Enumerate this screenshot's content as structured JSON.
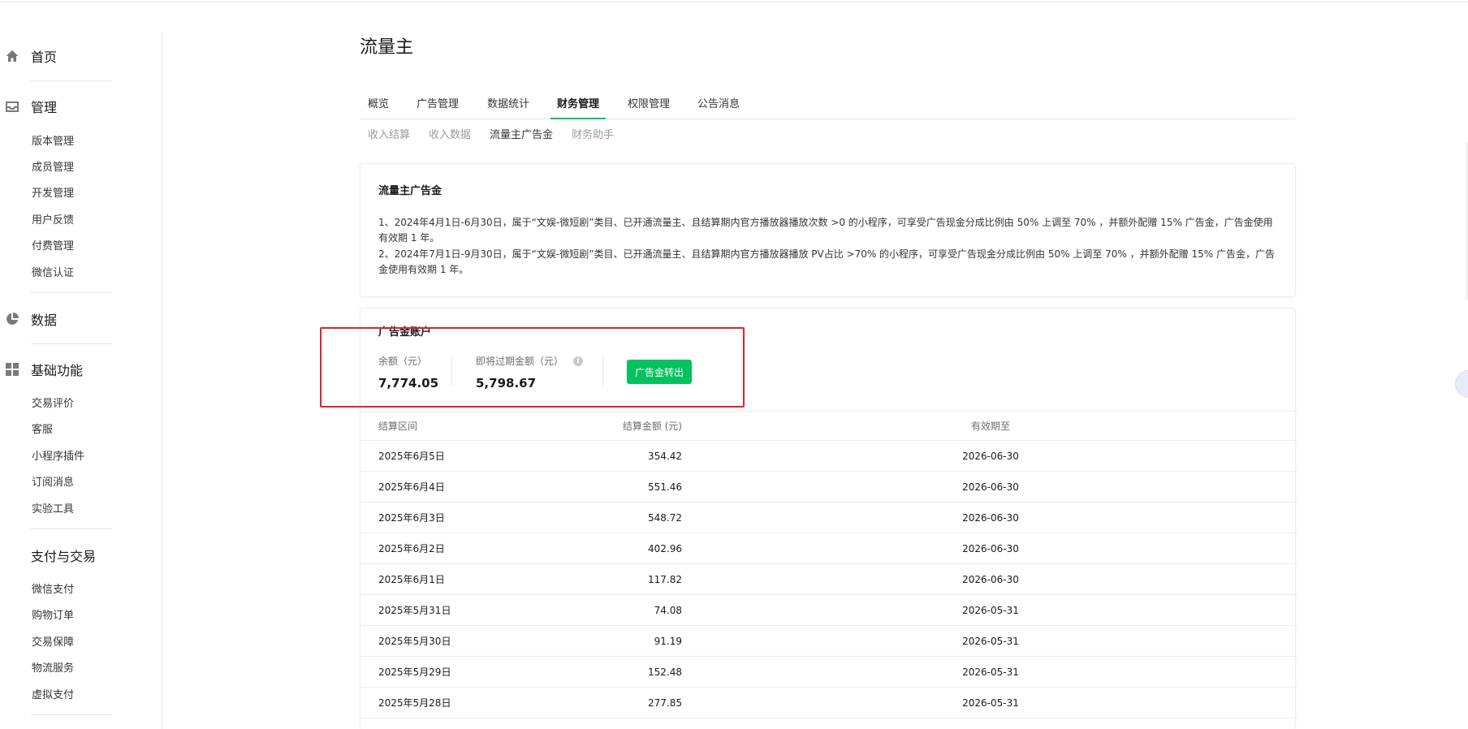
{
  "sidebar": {
    "home": "首页",
    "manage": {
      "title": "管理",
      "items": [
        "版本管理",
        "成员管理",
        "开发管理",
        "用户反馈",
        "付费管理",
        "微信认证"
      ]
    },
    "data": "数据",
    "basic": {
      "title": "基础功能",
      "items": [
        "交易评价",
        "客服",
        "小程序插件",
        "订阅消息",
        "实验工具"
      ]
    },
    "payment": {
      "title": "支付与交易",
      "items": [
        "微信支付",
        "购物订单",
        "交易保障",
        "物流服务",
        "虚拟支付"
      ]
    }
  },
  "page": {
    "title": "流量主"
  },
  "tabs": [
    "概览",
    "广告管理",
    "数据统计",
    "财务管理",
    "权限管理",
    "公告消息"
  ],
  "active_tab": "财务管理",
  "subtabs": [
    "收入结算",
    "收入数据",
    "流量主广告金",
    "财务助手"
  ],
  "active_subtab": "流量主广告金",
  "notice": {
    "title": "流量主广告金",
    "line1": "1、2024年4月1日-6月30日，属于“文娱-微短剧”类目、已开通流量主、且结算期内官方播放器播放次数 >0 的小程序，可享受广告现金分成比例由 50% 上调至 70% ，并额外配赠 15% 广告金，广告金使用有效期 1 年。",
    "line2": "2、2024年7月1日-9月30日，属于“文娱-微短剧”类目、已开通流量主、且结算期内官方播放器播放 PV占比 >70% 的小程序，可享受广告现金分成比例由 50% 上调至 70% ，并额外配赠 15% 广告金，广告金使用有效期 1 年。"
  },
  "account": {
    "title": "广告金账户",
    "balance_label": "余额（元）",
    "balance_value": "7,774.05",
    "expiring_label": "即将过期金额（元）",
    "expiring_value": "5,798.67",
    "transfer_button": "广告金转出"
  },
  "table": {
    "headers": [
      "结算区间",
      "结算金额 (元)",
      "有效期至"
    ],
    "rows": [
      [
        "2025年6月5日",
        "354.42",
        "2026-06-30"
      ],
      [
        "2025年6月4日",
        "551.46",
        "2026-06-30"
      ],
      [
        "2025年6月3日",
        "548.72",
        "2026-06-30"
      ],
      [
        "2025年6月2日",
        "402.96",
        "2026-06-30"
      ],
      [
        "2025年6月1日",
        "117.82",
        "2026-06-30"
      ],
      [
        "2025年5月31日",
        "74.08",
        "2026-05-31"
      ],
      [
        "2025年5月30日",
        "91.19",
        "2026-05-31"
      ],
      [
        "2025年5月29日",
        "152.48",
        "2026-05-31"
      ],
      [
        "2025年5月28日",
        "277.85",
        "2026-05-31"
      ]
    ]
  },
  "colors": {
    "accent": "#07c160",
    "highlight_box": "#e0232b"
  }
}
